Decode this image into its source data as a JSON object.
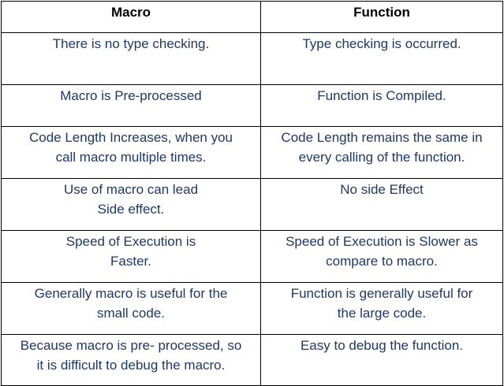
{
  "table": {
    "headers": [
      "Macro",
      "Function"
    ],
    "rows": [
      {
        "macro": [
          "There is no type checking."
        ],
        "function": [
          "Type checking is occurred."
        ]
      },
      {
        "macro": [
          "Macro is Pre-processed"
        ],
        "function": [
          "Function is Compiled."
        ]
      },
      {
        "macro": [
          "Code Length Increases, when you",
          "call macro multiple times."
        ],
        "function": [
          "Code Length remains the same in",
          "every calling of the function."
        ]
      },
      {
        "macro": [
          "Use of macro can lead",
          "Side effect."
        ],
        "function": [
          "No side Effect"
        ]
      },
      {
        "macro": [
          "Speed of Execution is",
          "Faster."
        ],
        "function": [
          "Speed of Execution is Slower as",
          "compare to macro."
        ]
      },
      {
        "macro": [
          "Generally macro is useful for the",
          "small code."
        ],
        "function": [
          "Function is generally useful for",
          "the large code."
        ]
      },
      {
        "macro": [
          "Because macro is pre- processed, so",
          "it is difficult to debug the macro."
        ],
        "function": [
          "Easy to debug the function."
        ]
      }
    ]
  },
  "colors": {
    "header_text": "#000000",
    "cell_text": "#1f3864",
    "border": "#000000",
    "background": "#ffffff"
  }
}
